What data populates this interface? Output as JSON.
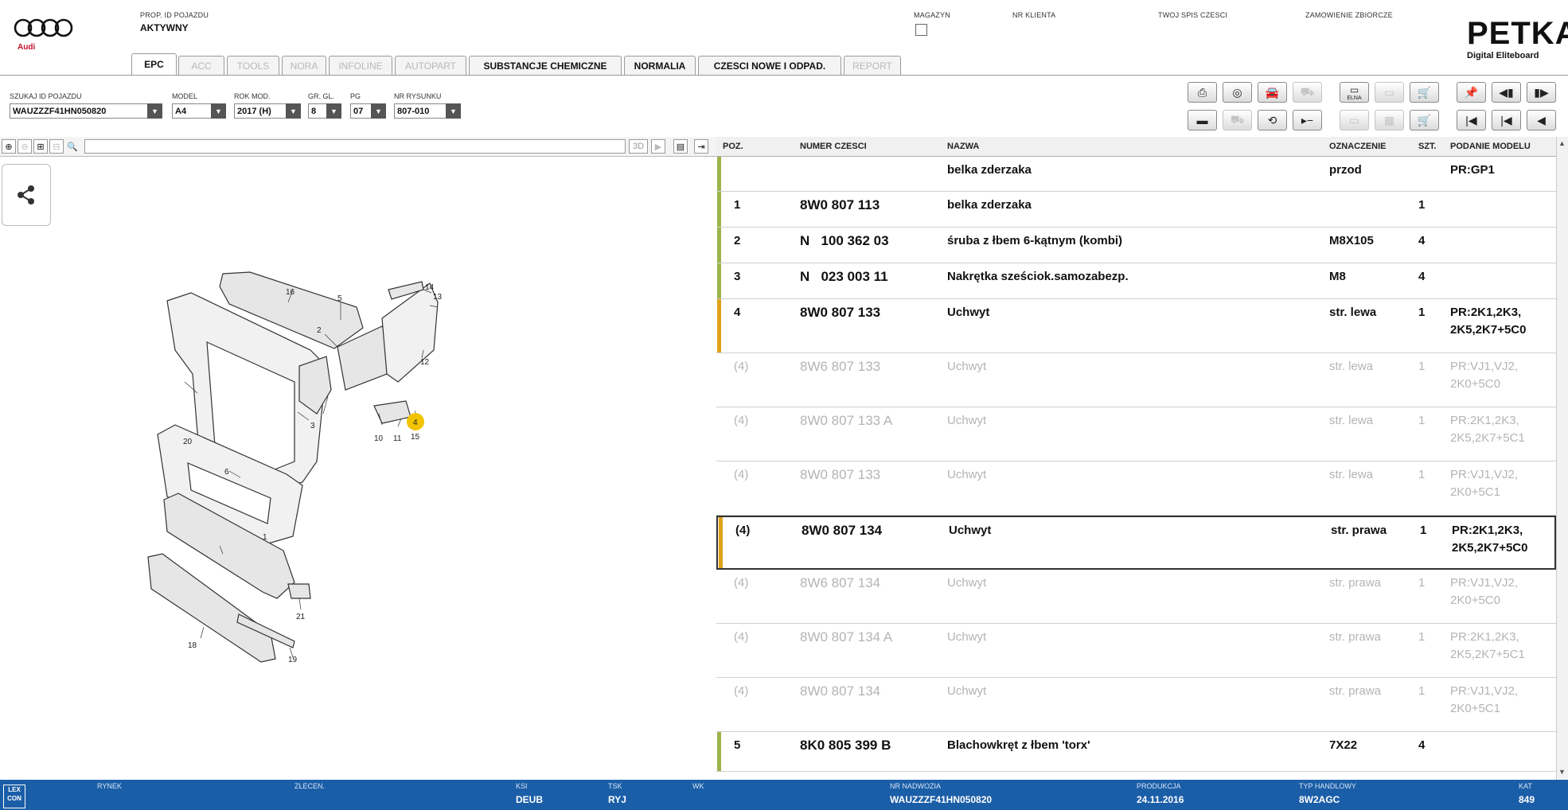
{
  "brand": {
    "audi_text": "Audi",
    "petka_title": "PETKA",
    "petka_sub": "Digital Eliteboard"
  },
  "header": {
    "prop_label": "PROP. ID POJAZDU",
    "prop_value": "AKTYWNY",
    "magazyn_label": "MAGAZYN",
    "nr_klienta_label": "NR KLIENTA",
    "spis_label": "TWOJ SPIS CZESCI",
    "zamowienie_label": "ZAMOWIENIE ZBIORCZE"
  },
  "tabs": [
    {
      "label": "EPC",
      "state": "active"
    },
    {
      "label": "ACC",
      "state": "disabled"
    },
    {
      "label": "TOOLS",
      "state": "disabled"
    },
    {
      "label": "NORA",
      "state": "disabled"
    },
    {
      "label": "INFOLINE",
      "state": "disabled"
    },
    {
      "label": "AUTOPART",
      "state": "disabled"
    },
    {
      "label": "SUBSTANCJE CHEMICZNE",
      "state": "enabled"
    },
    {
      "label": "NORMALIA",
      "state": "enabled"
    },
    {
      "label": "CZESCI NOWE I ODPAD.",
      "state": "enabled"
    },
    {
      "label": "REPORT",
      "state": "disabled"
    }
  ],
  "filters": {
    "vin": {
      "label": "SZUKAJ ID POJAZDU",
      "value": "WAUZZZF41HN050820"
    },
    "model": {
      "label": "MODEL",
      "value": "A4"
    },
    "rok": {
      "label": "ROK MOD.",
      "value": "2017 (H)"
    },
    "gr": {
      "label": "GR. GL.",
      "value": "8"
    },
    "pg": {
      "label": "PG",
      "value": "07"
    },
    "nr": {
      "label": "NR RYSUNKU",
      "value": "807-010"
    }
  },
  "toolbar": {
    "elna": "ELNA",
    "icons": [
      "print-icon",
      "stamp-icon",
      "car-check-icon",
      "car-disabled-icon",
      "elna-icon",
      "info-disabled-icon",
      "cart-add-icon",
      "pin-icon",
      "prev-page-icon",
      "next-page-icon",
      "screen-icon",
      "car-drive-disabled-icon",
      "car-tilt-icon",
      "step-icon",
      "info2-disabled-icon",
      "part-disabled-icon",
      "cart-icon",
      "first-icon",
      "prev-icon",
      "back-icon"
    ]
  },
  "drawing": {
    "toggle_3d": "3D",
    "callouts": [
      "16",
      "5",
      "2",
      "14",
      "13",
      "12",
      "4",
      "3",
      "10",
      "11",
      "15",
      "20",
      "6",
      "1",
      "21",
      "18",
      "19"
    ]
  },
  "table": {
    "headers": {
      "poz": "POZ.",
      "numer": "NUMER CZESCI",
      "nazwa": "NAZWA",
      "oznaczenie": "OZNACZENIE",
      "szt": "SZT.",
      "podanie": "PODANIE MODELU"
    },
    "rows": [
      {
        "poz": "",
        "numer": "",
        "nazwa": "belka zderzaka",
        "oznaczenie": "przod",
        "szt": "",
        "model1": "PR:GP1",
        "model2": "",
        "state": "header",
        "bar": "#9bb34a"
      },
      {
        "poz": "1",
        "numer": "8W0 807 113",
        "nazwa": "belka zderzaka",
        "oznaczenie": "",
        "szt": "1",
        "model1": "",
        "model2": "",
        "state": "active",
        "bar": "#9bb34a"
      },
      {
        "poz": "2",
        "numer": "N   100 362 03",
        "nazwa": "śruba z łbem 6-kątnym (kombi)",
        "oznaczenie": "M8X105",
        "szt": "4",
        "model1": "",
        "model2": "",
        "state": "active",
        "bar": "#9bb34a"
      },
      {
        "poz": "3",
        "numer": "N   023 003 11",
        "nazwa": "Nakrętka sześciok.samozabezp.",
        "oznaczenie": "M8",
        "szt": "4",
        "model1": "",
        "model2": "",
        "state": "active",
        "bar": "#9bb34a"
      },
      {
        "poz": "4",
        "numer": "8W0 807 133",
        "nazwa": "Uchwyt",
        "oznaczenie": "str. lewa",
        "szt": "1",
        "model1": "PR:2K1,2K3,",
        "model2": "2K5,2K7+5C0",
        "state": "active",
        "bar": "#e0a21a"
      },
      {
        "poz": "(4)",
        "numer": "8W6 807 133",
        "nazwa": "Uchwyt",
        "oznaczenie": "str. lewa",
        "szt": "1",
        "model1": "PR:VJ1,VJ2,",
        "model2": "2K0+5C0",
        "state": "inactive",
        "bar": ""
      },
      {
        "poz": "(4)",
        "numer": "8W0 807 133 A",
        "nazwa": "Uchwyt",
        "oznaczenie": "str. lewa",
        "szt": "1",
        "model1": "PR:2K1,2K3,",
        "model2": "2K5,2K7+5C1",
        "state": "inactive",
        "bar": ""
      },
      {
        "poz": "(4)",
        "numer": "8W0 807 133",
        "nazwa": "Uchwyt",
        "oznaczenie": "str. lewa",
        "szt": "1",
        "model1": "PR:VJ1,VJ2,",
        "model2": "2K0+5C1",
        "state": "inactive",
        "bar": ""
      },
      {
        "poz": "(4)",
        "numer": "8W0 807 134",
        "nazwa": "Uchwyt",
        "oznaczenie": "str. prawa",
        "szt": "1",
        "model1": "PR:2K1,2K3,",
        "model2": "2K5,2K7+5C0",
        "state": "selected",
        "bar": "#e0a21a"
      },
      {
        "poz": "(4)",
        "numer": "8W6 807 134",
        "nazwa": "Uchwyt",
        "oznaczenie": "str. prawa",
        "szt": "1",
        "model1": "PR:VJ1,VJ2,",
        "model2": "2K0+5C0",
        "state": "inactive",
        "bar": ""
      },
      {
        "poz": "(4)",
        "numer": "8W0 807 134 A",
        "nazwa": "Uchwyt",
        "oznaczenie": "str. prawa",
        "szt": "1",
        "model1": "PR:2K1,2K3,",
        "model2": "2K5,2K7+5C1",
        "state": "inactive",
        "bar": ""
      },
      {
        "poz": "(4)",
        "numer": "8W0 807 134",
        "nazwa": "Uchwyt",
        "oznaczenie": "str. prawa",
        "szt": "1",
        "model1": "PR:VJ1,VJ2,",
        "model2": "2K0+5C1",
        "state": "inactive",
        "bar": ""
      },
      {
        "poz": "5",
        "numer": "8K0 805 399 B",
        "nazwa": "Blachowkręt z łbem 'torx'",
        "oznaczenie": "7X22",
        "szt": "4",
        "model1": "",
        "model2": "",
        "state": "active",
        "bar": "#9bb34a"
      }
    ]
  },
  "status": {
    "lex": "LEX CON",
    "rynek": {
      "label": "RYNEK",
      "value": ""
    },
    "zlecen": {
      "label": "ZLECEN.",
      "value": ""
    },
    "ksi": {
      "label": "KSI",
      "value": "DEUB"
    },
    "tsk": {
      "label": "TSK",
      "value": "RYJ"
    },
    "wk": {
      "label": "WK",
      "value": ""
    },
    "nadwozia": {
      "label": "NR NADWOZIA",
      "value": "WAUZZZF41HN050820"
    },
    "produkcja": {
      "label": "PRODUKCJA",
      "value": "24.11.2016"
    },
    "typ": {
      "label": "TYP HANDLOWY",
      "value": "8W2AGC"
    },
    "kat": {
      "label": "KAT",
      "value": "849"
    }
  }
}
